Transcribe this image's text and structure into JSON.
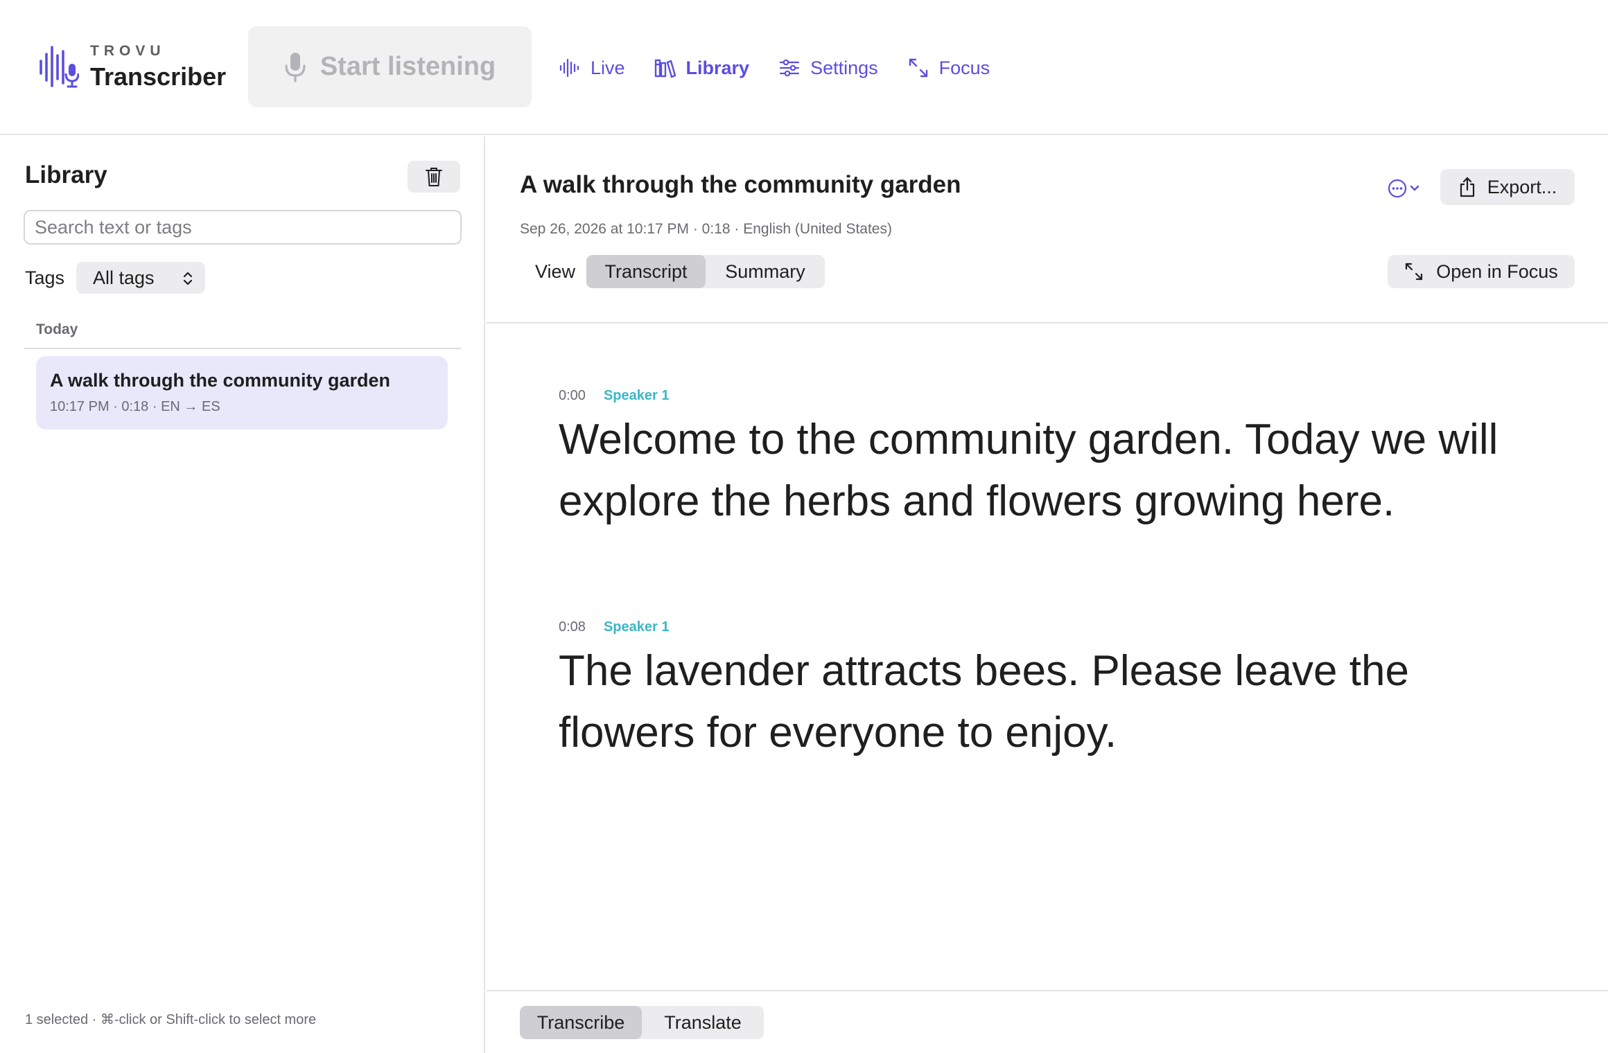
{
  "app": {
    "brand_kicker": "TROVU",
    "brand_name": "Transcriber",
    "accent_color": "#5b4ee0",
    "speaker_color": "#3ab7c7"
  },
  "toolbar": {
    "start_label": "Start listening",
    "nav": [
      {
        "label": "Live",
        "icon": "waveform-icon",
        "active": false
      },
      {
        "label": "Library",
        "icon": "books-icon",
        "active": true
      },
      {
        "label": "Settings",
        "icon": "sliders-icon",
        "active": false
      },
      {
        "label": "Focus",
        "icon": "expand-arrows-icon",
        "active": false
      }
    ]
  },
  "sidebar": {
    "title": "Library",
    "search_placeholder": "Search text or tags",
    "tags_label": "Tags",
    "tags_value": "All tags",
    "group_header": "Today",
    "items": [
      {
        "title": "A walk through the community garden",
        "meta": "10:17 PM · 0:18 · EN → ES",
        "selected": true
      }
    ],
    "footer": "1 selected · ⌘-click or Shift-click to select more"
  },
  "detail": {
    "title": "A walk through the community garden",
    "meta": "Sep 26, 2026 at 10:17 PM · 0:18 · English (United States)",
    "export_label": "Export...",
    "view_label": "View",
    "view_options": [
      "Transcript",
      "Summary"
    ],
    "view_selected": "Transcript",
    "open_focus_label": "Open in Focus",
    "segments": [
      {
        "time": "0:00",
        "speaker": "Speaker 1",
        "text": "Welcome to the community garden. Today we will explore the herbs and flowers growing here."
      },
      {
        "time": "0:08",
        "speaker": "Speaker 1",
        "text": "The lavender attracts bees. Please leave the flowers for everyone to enjoy."
      }
    ],
    "mode_options": [
      "Transcribe",
      "Translate"
    ],
    "mode_selected": "Transcribe"
  }
}
